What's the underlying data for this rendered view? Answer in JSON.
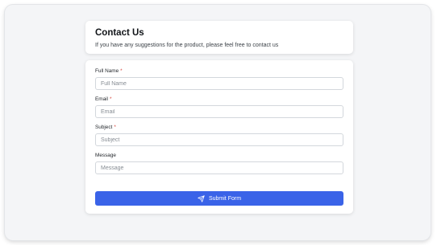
{
  "header": {
    "title": "Contact Us",
    "subtitle": "If you have any suggestions for the product, please feel free to contact us"
  },
  "form": {
    "fields": [
      {
        "label": "Full Name",
        "required_mark": "*",
        "placeholder": "Full Name",
        "value": ""
      },
      {
        "label": "Email",
        "required_mark": "*",
        "placeholder": "Email",
        "value": ""
      },
      {
        "label": "Subject",
        "required_mark": "*",
        "placeholder": "Subject",
        "value": ""
      },
      {
        "label": "Message",
        "placeholder": "Message",
        "value": ""
      }
    ],
    "submit_label": "Submit Form",
    "submit_icon": "send-icon"
  },
  "colors": {
    "accent": "#3a63e8",
    "required": "#d6453d",
    "background": "#f4f5f7"
  }
}
